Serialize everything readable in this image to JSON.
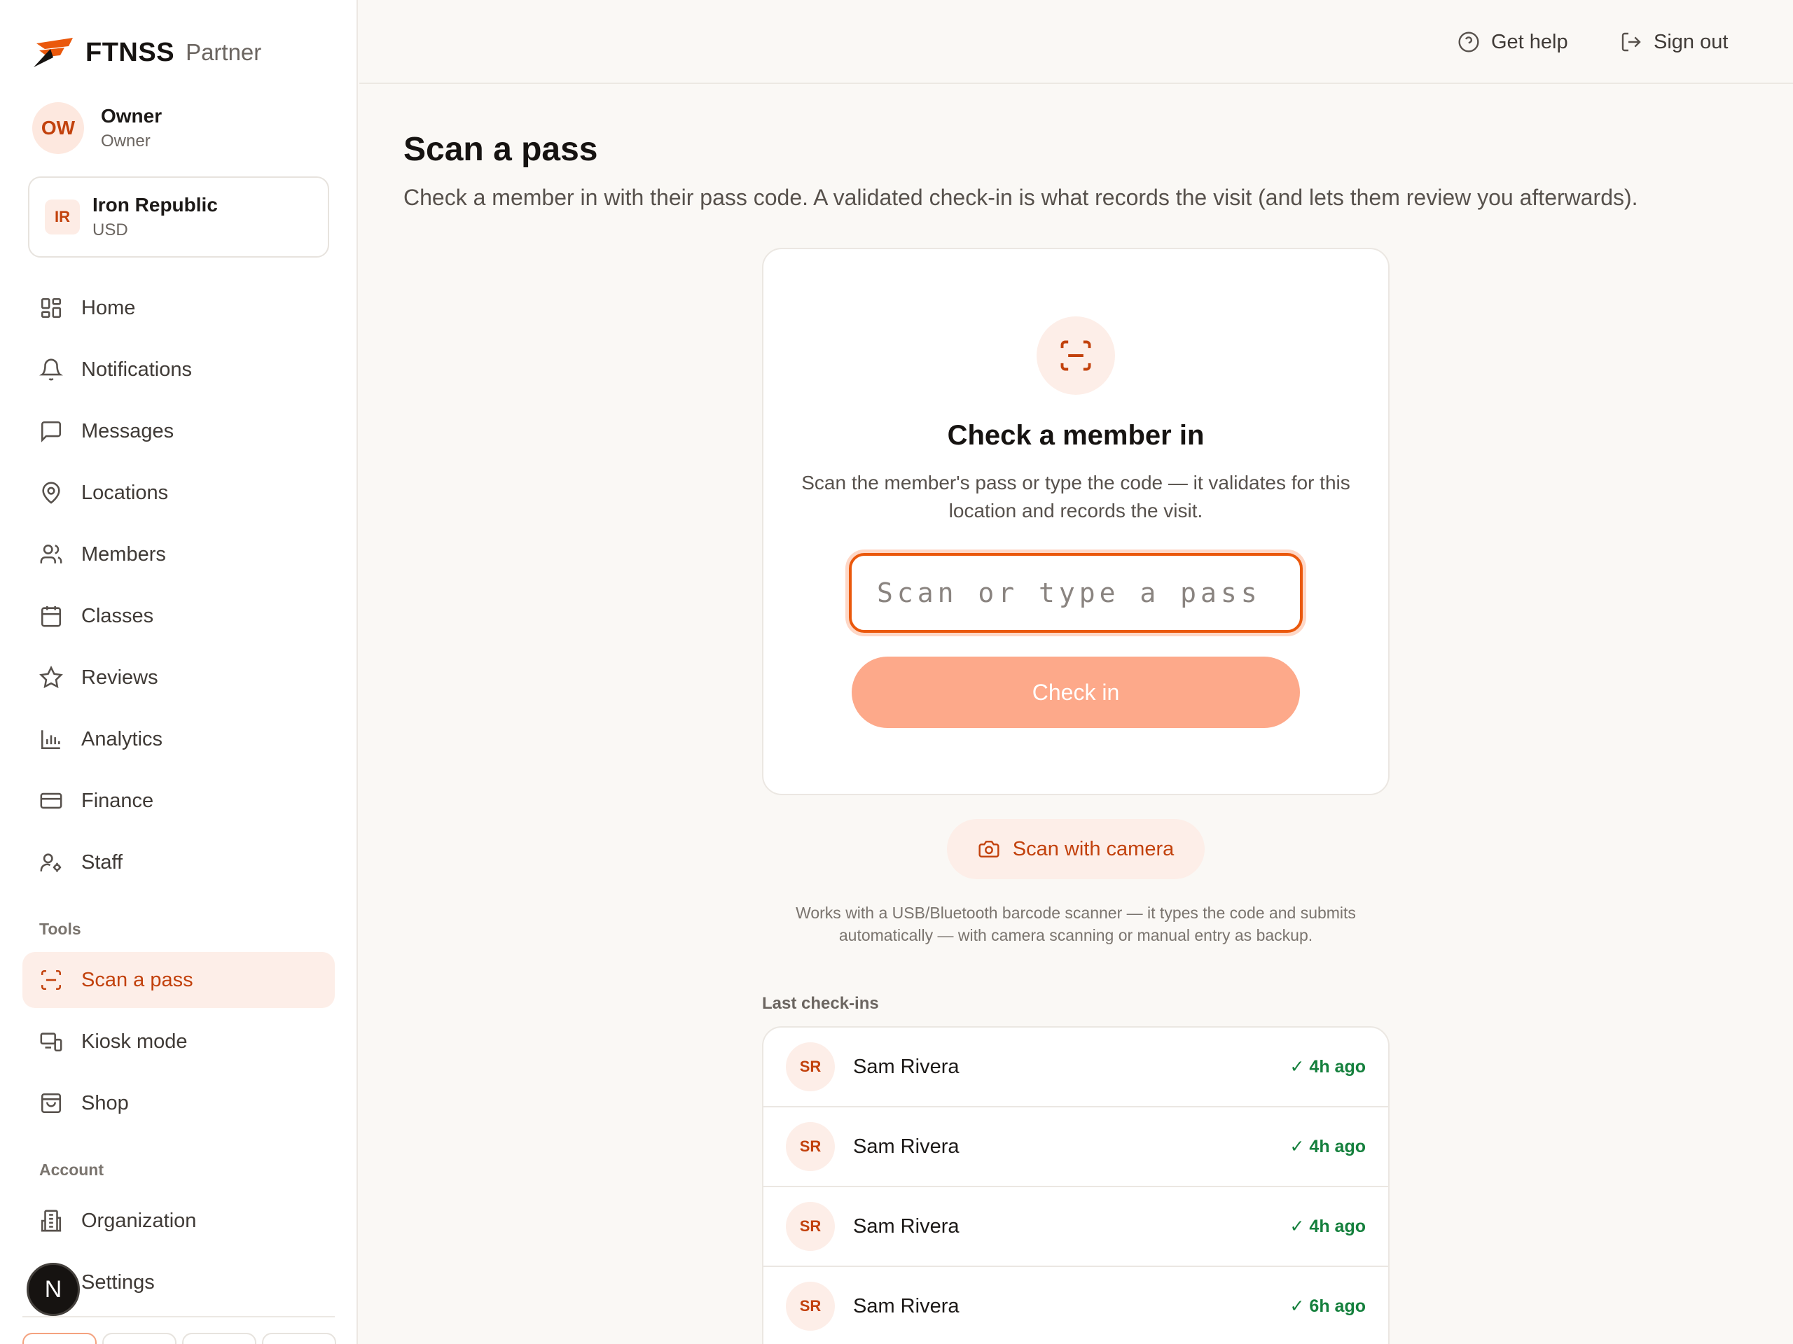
{
  "brand": {
    "name": "FTNSS",
    "sub": "Partner"
  },
  "user": {
    "initials": "OW",
    "name": "Owner",
    "role": "Owner"
  },
  "org": {
    "initials": "IR",
    "name": "Iron Republic",
    "currency": "USD"
  },
  "nav": {
    "items": [
      {
        "label": "Home",
        "icon": "grid-icon"
      },
      {
        "label": "Notifications",
        "icon": "bell-icon"
      },
      {
        "label": "Messages",
        "icon": "message-icon"
      },
      {
        "label": "Locations",
        "icon": "map-pin-icon"
      },
      {
        "label": "Members",
        "icon": "users-icon"
      },
      {
        "label": "Classes",
        "icon": "calendar-icon"
      },
      {
        "label": "Reviews",
        "icon": "star-icon"
      },
      {
        "label": "Analytics",
        "icon": "bar-chart-icon"
      },
      {
        "label": "Finance",
        "icon": "credit-card-icon"
      },
      {
        "label": "Staff",
        "icon": "user-gear-icon"
      }
    ],
    "tools_label": "Tools",
    "tools": [
      {
        "label": "Scan a pass",
        "icon": "scan-icon",
        "active": true
      },
      {
        "label": "Kiosk mode",
        "icon": "kiosk-icon"
      },
      {
        "label": "Shop",
        "icon": "shopping-bag-icon"
      }
    ],
    "account_label": "Account",
    "account": [
      {
        "label": "Organization",
        "icon": "building-icon"
      },
      {
        "label": "Settings",
        "icon": "settings-icon"
      }
    ]
  },
  "fab": {
    "letter": "N"
  },
  "topbar": {
    "help_label": "Get help",
    "signout_label": "Sign out"
  },
  "page": {
    "title": "Scan a pass",
    "description": "Check a member in with their pass code. A validated check-in is what records the visit (and lets them review you afterwards)."
  },
  "checkin_card": {
    "title": "Check a member in",
    "text": "Scan the member's pass or type the code — it validates for this location and records the visit.",
    "input_placeholder": "Scan or type a pass code",
    "input_value": "",
    "button_label": "Check in"
  },
  "camera": {
    "label": "Scan with camera"
  },
  "helper_text": "Works with a USB/Bluetooth barcode scanner — it types the code and submits automatically — with camera scanning or manual entry as backup.",
  "checkins": {
    "label": "Last check-ins",
    "rows": [
      {
        "initials": "SR",
        "name": "Sam Rivera",
        "time": "✓ 4h ago"
      },
      {
        "initials": "SR",
        "name": "Sam Rivera",
        "time": "✓ 4h ago"
      },
      {
        "initials": "SR",
        "name": "Sam Rivera",
        "time": "✓ 4h ago"
      },
      {
        "initials": "SR",
        "name": "Sam Rivera",
        "time": "✓ 6h ago"
      }
    ]
  },
  "colors": {
    "accent": "#ea580c",
    "accent_soft": "#fdeee8",
    "success": "#15803d"
  }
}
